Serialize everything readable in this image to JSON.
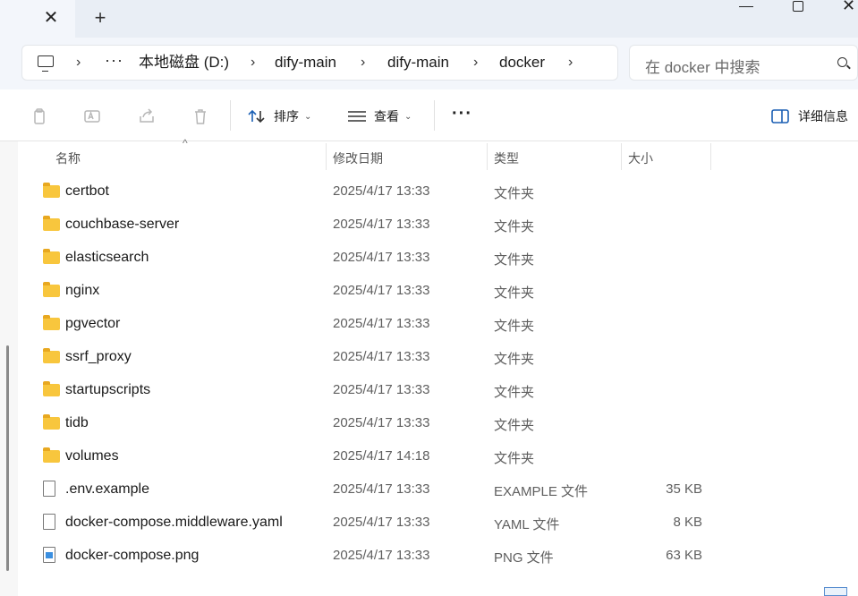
{
  "titlebar": {
    "close_tab_glyph": "✕",
    "new_tab_glyph": "+",
    "window_close_glyph": "✕"
  },
  "address": {
    "pc_icon": "computer-icon",
    "ellipsis": "···",
    "sep": "›",
    "crumbs": [
      "本地磁盘 (D:)",
      "dify-main",
      "dify-main",
      "docker"
    ]
  },
  "search": {
    "placeholder": "在 docker 中搜索",
    "icon": "search-icon"
  },
  "toolbar": {
    "sort_label": "排序",
    "view_label": "查看",
    "more_label": "···",
    "details_label": "详细信息"
  },
  "columns": {
    "name": "名称",
    "modified": "修改日期",
    "type": "类型",
    "size": "大小"
  },
  "files": [
    {
      "name": "certbot",
      "modified": "2025/4/17 13:33",
      "type": "文件夹",
      "size": "",
      "icon": "folder"
    },
    {
      "name": "couchbase-server",
      "modified": "2025/4/17 13:33",
      "type": "文件夹",
      "size": "",
      "icon": "folder"
    },
    {
      "name": "elasticsearch",
      "modified": "2025/4/17 13:33",
      "type": "文件夹",
      "size": "",
      "icon": "folder"
    },
    {
      "name": "nginx",
      "modified": "2025/4/17 13:33",
      "type": "文件夹",
      "size": "",
      "icon": "folder"
    },
    {
      "name": "pgvector",
      "modified": "2025/4/17 13:33",
      "type": "文件夹",
      "size": "",
      "icon": "folder"
    },
    {
      "name": "ssrf_proxy",
      "modified": "2025/4/17 13:33",
      "type": "文件夹",
      "size": "",
      "icon": "folder"
    },
    {
      "name": "startupscripts",
      "modified": "2025/4/17 13:33",
      "type": "文件夹",
      "size": "",
      "icon": "folder"
    },
    {
      "name": "tidb",
      "modified": "2025/4/17 13:33",
      "type": "文件夹",
      "size": "",
      "icon": "folder"
    },
    {
      "name": "volumes",
      "modified": "2025/4/17 14:18",
      "type": "文件夹",
      "size": "",
      "icon": "folder"
    },
    {
      "name": ".env.example",
      "modified": "2025/4/17 13:33",
      "type": "EXAMPLE 文件",
      "size": "35 KB",
      "icon": "file"
    },
    {
      "name": "docker-compose.middleware.yaml",
      "modified": "2025/4/17 13:33",
      "type": "YAML 文件",
      "size": "8 KB",
      "icon": "file"
    },
    {
      "name": "docker-compose.png",
      "modified": "2025/4/17 13:33",
      "type": "PNG 文件",
      "size": "63 KB",
      "icon": "image"
    }
  ]
}
